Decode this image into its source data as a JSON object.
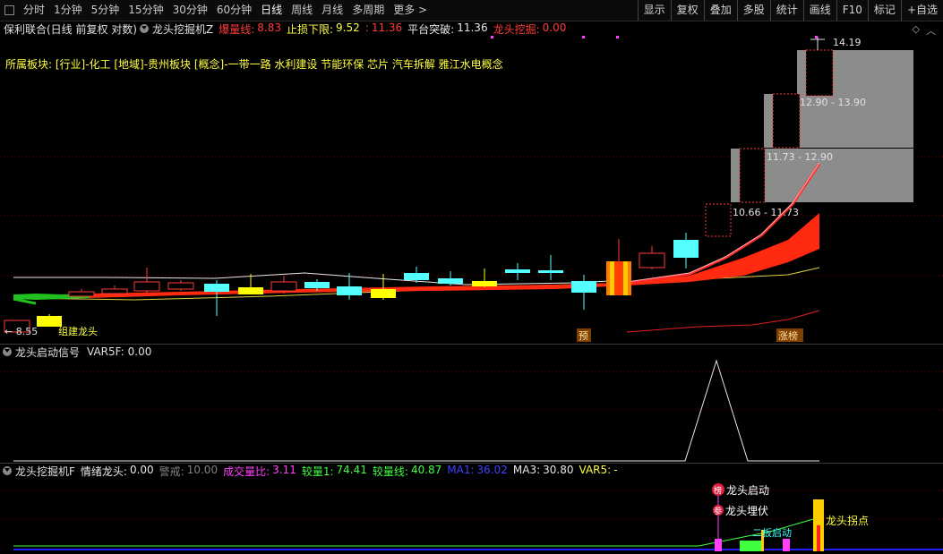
{
  "toolbar": {
    "periods": [
      "分时",
      "1分钟",
      "5分钟",
      "15分钟",
      "30分钟",
      "60分钟",
      "日线",
      "周线",
      "月线",
      "多周期",
      "更多"
    ],
    "active_period": "日线",
    "right_buttons": [
      "显示",
      "复权",
      "叠加",
      "多股",
      "统计",
      "画线",
      "F10",
      "标记",
      "+自选"
    ]
  },
  "main_panel": {
    "stock_title": "保利联合(日线 前复权 对数)",
    "indicator_name": "龙头挖掘机Z",
    "fields": [
      {
        "label": "爆量线:",
        "value": "8.83",
        "color": "#ff3a3a"
      },
      {
        "label": "止损下限:",
        "value": "9.52",
        "color": "#ffff40"
      },
      {
        "label": ":",
        "value": "11.36",
        "color": "#ff3a3a"
      },
      {
        "label": "平台突破:",
        "value": "11.36",
        "color": "#e8e8e8"
      },
      {
        "label": "龙头挖掘:",
        "value": "0.00",
        "color": "#ff3a3a"
      }
    ],
    "sector_text": "所属板块: [行业]-化工 [地域]-贵州板块 [概念]-一带一路 水利建设 节能环保 芯片 汽车拆解 雅江水电概念",
    "price_low_label": "← 8.55",
    "price_high_label": "14.19",
    "bottom_left_text": "组建龙头",
    "marker_yu": "预",
    "marker_zhangbang": "涨榜",
    "levels": [
      {
        "label": "12.90 - 13.90"
      },
      {
        "label": "11.73 - 12.90"
      },
      {
        "label": "10.66 - 11.73"
      }
    ]
  },
  "signal_panel": {
    "indicator_name": "龙头启动信号",
    "field_label": "VAR5F:",
    "field_value": "0.00"
  },
  "bottom_panel": {
    "indicator_name": "龙头挖掘机F",
    "fields": [
      {
        "label": "情绪龙头:",
        "value": "0.00",
        "color": "#e8e8e8"
      },
      {
        "label": "警戒:",
        "value": "10.00",
        "color": "#808080"
      },
      {
        "label": "成交量比:",
        "value": "3.11",
        "color": "#ff40ff"
      },
      {
        "label": "较量1:",
        "value": "74.41",
        "color": "#40ff40"
      },
      {
        "label": "较量线:",
        "value": "40.87",
        "color": "#40ff40"
      },
      {
        "label": "MA1:",
        "value": "36.02",
        "color": "#4040ff"
      },
      {
        "label": "MA3:",
        "value": "30.80",
        "color": "#e8e8e8"
      },
      {
        "label": "VAR5:",
        "value": "-",
        "color": "#ffff40"
      }
    ],
    "annotations": {
      "bang": "榜",
      "longtou_qidong": "龙头启动",
      "can": "参",
      "longtou_maifu": "龙头埋伏",
      "erban_qidong": "二板启动",
      "longtou_guaidian": "龙头拐点"
    }
  },
  "colors": {
    "up": "#ff3a3a",
    "down": "#54ffff",
    "yellow": "#ffff00",
    "grid": "#7a0000"
  }
}
